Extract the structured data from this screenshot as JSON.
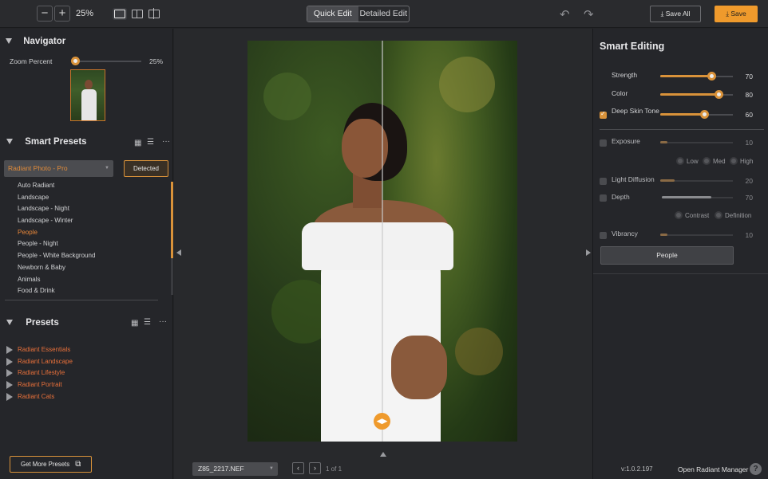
{
  "toolbar": {
    "zoom_out_label": "−",
    "zoom_in_label": "+",
    "zoom_value": "25%",
    "views": [
      "single-view-icon",
      "split-view-icon",
      "side-by-side-view-icon"
    ],
    "mode_tabs": [
      "Quick Edit",
      "Detailed Edit"
    ],
    "active_mode": "Quick Edit",
    "undo_icon": "undo-icon",
    "redo_icon": "redo-icon",
    "save_all_label": "Save All",
    "save_label": "Save"
  },
  "navigator": {
    "title": "Navigator",
    "zoom_label": "Zoom Percent",
    "zoom_value": "25%",
    "zoom_fraction": 0.0
  },
  "smart_presets": {
    "title": "Smart Presets",
    "dropdown_value": "Radiant Photo - Pro",
    "detected_label": "Detected",
    "items": [
      "Auto Radiant",
      "Landscape",
      "Landscape - Night",
      "Landscape - Winter",
      "People",
      "People - Night",
      "People - White Background",
      "Newborn & Baby",
      "Animals",
      "Food & Drink"
    ],
    "selected": "People"
  },
  "presets": {
    "title": "Presets",
    "items": [
      "Radiant Essentials",
      "Radiant Landscape",
      "Radiant Lifestyle",
      "Radiant Portrait",
      "Radiant Cats"
    ],
    "get_more_label": "Get More Presets"
  },
  "center": {
    "file_name": "Z85_2217.NEF",
    "page_count": "1 of 1",
    "prev_label": "‹",
    "next_label": "›"
  },
  "smart_editing": {
    "title": "Smart Editing",
    "sliders": [
      {
        "label": "Strength",
        "value": "70",
        "fraction": 0.7,
        "enabled": true,
        "checkbox": false
      },
      {
        "label": "Color",
        "value": "80",
        "fraction": 0.8,
        "enabled": true,
        "checkbox": false
      },
      {
        "label": "Deep Skin Tone",
        "value": "60",
        "fraction": 0.6,
        "enabled": true,
        "checkbox": true,
        "checked": true
      },
      {
        "label": "Exposure",
        "value": "10",
        "fraction": 0.1,
        "enabled": false,
        "checkbox": true,
        "checked": false
      },
      {
        "label": "Light Diffusion",
        "value": "20",
        "fraction": 0.2,
        "enabled": false,
        "checkbox": true,
        "checked": false
      },
      {
        "label": "Depth",
        "value": "70",
        "fraction": 0.7,
        "enabled": false,
        "checkbox": true,
        "checked": false
      },
      {
        "label": "Vibrancy",
        "value": "10",
        "fraction": 0.1,
        "enabled": false,
        "checkbox": true,
        "checked": false
      }
    ],
    "exposure_options": [
      "Low",
      "Med",
      "High"
    ],
    "depth_options": [
      "Contrast",
      "Definition"
    ],
    "people_button": "People",
    "version": "v:1.0.2.197",
    "open_manager_label": "Open Radiant Manager",
    "help_label": "?"
  },
  "colors": {
    "accent": "#ef9a2c",
    "preset_link": "#e8703a",
    "background": "#232427"
  }
}
